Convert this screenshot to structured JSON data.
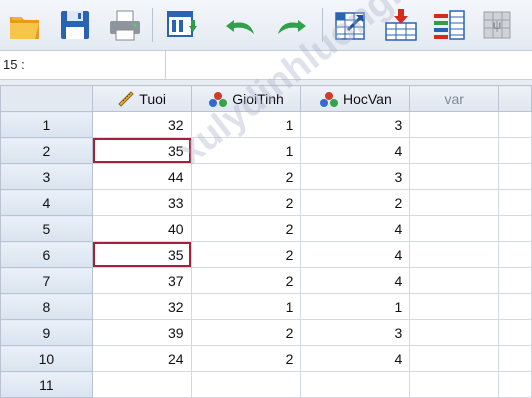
{
  "toolbar": {
    "buttons": [
      "open-icon",
      "save-icon",
      "print-icon",
      "recall-dialog-icon",
      "undo-icon",
      "redo-icon",
      "goto-case-icon",
      "goto-variable-icon",
      "variables-icon",
      "split-file-icon"
    ]
  },
  "cell_editor": {
    "ref": "15 :",
    "value": ""
  },
  "columns": [
    {
      "name": "Tuoi",
      "icon": "scale-ruler-icon"
    },
    {
      "name": "GioiTinh",
      "icon": "nominal-balls-icon"
    },
    {
      "name": "HocVan",
      "icon": "nominal-balls-icon"
    },
    {
      "name": "var",
      "icon": ""
    }
  ],
  "rows": [
    {
      "n": "1",
      "tuoi": "32",
      "gioitinh": "1",
      "hocvan": "3"
    },
    {
      "n": "2",
      "tuoi": "35",
      "gioitinh": "1",
      "hocvan": "4"
    },
    {
      "n": "3",
      "tuoi": "44",
      "gioitinh": "2",
      "hocvan": "3"
    },
    {
      "n": "4",
      "tuoi": "33",
      "gioitinh": "2",
      "hocvan": "2"
    },
    {
      "n": "5",
      "tuoi": "40",
      "gioitinh": "2",
      "hocvan": "4"
    },
    {
      "n": "6",
      "tuoi": "35",
      "gioitinh": "2",
      "hocvan": "4"
    },
    {
      "n": "7",
      "tuoi": "37",
      "gioitinh": "2",
      "hocvan": "4"
    },
    {
      "n": "8",
      "tuoi": "32",
      "gioitinh": "1",
      "hocvan": "1"
    },
    {
      "n": "9",
      "tuoi": "39",
      "gioitinh": "2",
      "hocvan": "3"
    },
    {
      "n": "10",
      "tuoi": "24",
      "gioitinh": "2",
      "hocvan": "4"
    },
    {
      "n": "11",
      "tuoi": "",
      "gioitinh": "",
      "hocvan": ""
    }
  ],
  "watermark": "xulydinhluong.com",
  "colors": {
    "highlight": "#a0223c"
  }
}
